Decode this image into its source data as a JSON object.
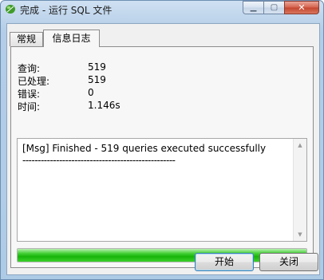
{
  "window": {
    "title": "完成 - 运行 SQL 文件",
    "app_icon": "navicat-leaf-icon",
    "controls": {
      "minimize": "minimize-icon",
      "maximize": "maximize-icon",
      "close": "close-icon"
    }
  },
  "tabs": [
    {
      "label": "常规",
      "active": false
    },
    {
      "label": "信息日志",
      "active": true
    }
  ],
  "stats": [
    {
      "label": "查询:",
      "value": "519"
    },
    {
      "label": "已处理:",
      "value": "519"
    },
    {
      "label": "错误:",
      "value": "0"
    },
    {
      "label": "时间:",
      "value": "1.146s"
    }
  ],
  "log": {
    "lines": [
      "[Msg] Finished - 519 queries executed successfully",
      "--------------------------------------------------"
    ]
  },
  "progress": {
    "percent": 100,
    "color": "#1fb812"
  },
  "buttons": {
    "start": "开始",
    "close": "关闭"
  }
}
